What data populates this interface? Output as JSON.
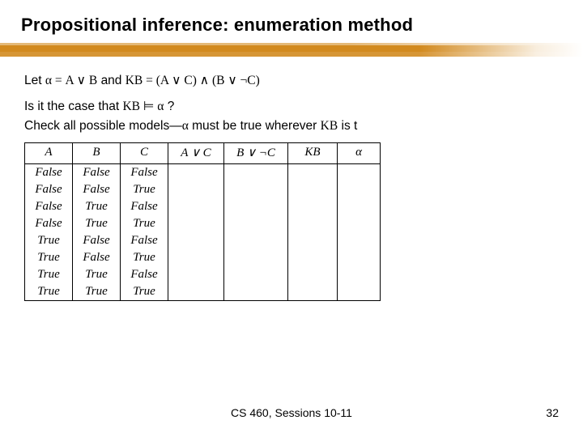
{
  "title": "Propositional inference: enumeration method",
  "let_prefix": "Let ",
  "alpha_eq": "α = A ∨ B",
  "and_word": " and ",
  "kb_eq": "KB = (A ∨ C) ∧ (B ∨ ¬C)",
  "q_prefix": "Is it the case that ",
  "kb_entails": "KB ⊨ α",
  "q_suffix": "?",
  "check_prefix": "Check all possible models—",
  "alpha": "α",
  "check_mid": " must be true wherever ",
  "kb": "KB",
  "check_suffix": " is t",
  "chart_data": {
    "type": "table",
    "columns": [
      "A",
      "B",
      "C",
      "A ∨ C",
      "B ∨ ¬C",
      "KB",
      "α"
    ],
    "rows": [
      [
        "False",
        "False",
        "False",
        "",
        "",
        "",
        ""
      ],
      [
        "False",
        "False",
        "True",
        "",
        "",
        "",
        ""
      ],
      [
        "False",
        "True",
        "False",
        "",
        "",
        "",
        ""
      ],
      [
        "False",
        "True",
        "True",
        "",
        "",
        "",
        ""
      ],
      [
        "True",
        "False",
        "False",
        "",
        "",
        "",
        ""
      ],
      [
        "True",
        "False",
        "True",
        "",
        "",
        "",
        ""
      ],
      [
        "True",
        "True",
        "False",
        "",
        "",
        "",
        ""
      ],
      [
        "True",
        "True",
        "True",
        "",
        "",
        "",
        ""
      ]
    ],
    "col_classes": [
      "col-a",
      "col-b",
      "col-c",
      "col-aoc",
      "col-bonc",
      "col-kb",
      "col-alph"
    ]
  },
  "footer": "CS 460,  Sessions 10-11",
  "page_number": "32"
}
